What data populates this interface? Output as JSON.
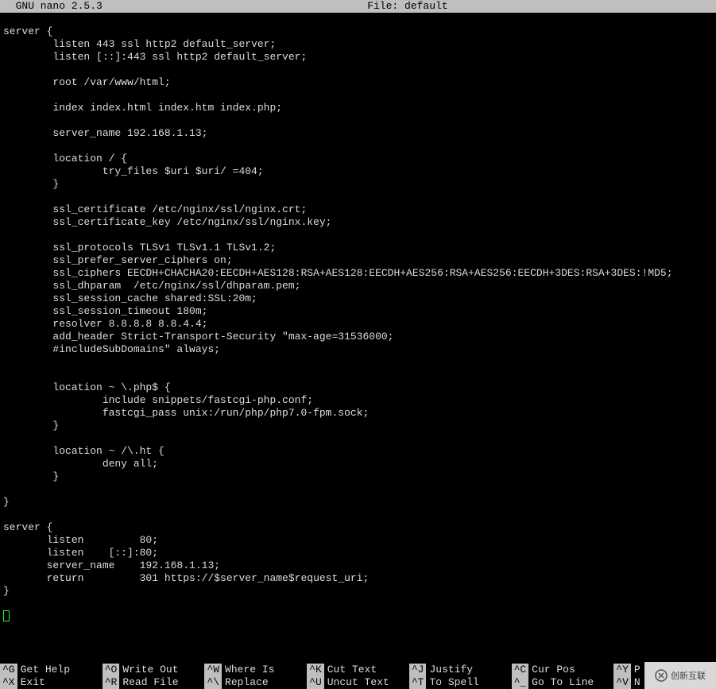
{
  "titlebar": {
    "app": "  GNU nano 2.5.3",
    "file": "File: default"
  },
  "content": "\nserver {\n        listen 443 ssl http2 default_server;\n        listen [::]:443 ssl http2 default_server;\n\n        root /var/www/html;\n\n        index index.html index.htm index.php;\n\n        server_name 192.168.1.13;\n\n        location / {\n                try_files $uri $uri/ =404;\n        }\n\n        ssl_certificate /etc/nginx/ssl/nginx.crt;\n        ssl_certificate_key /etc/nginx/ssl/nginx.key;\n\n        ssl_protocols TLSv1 TLSv1.1 TLSv1.2;\n        ssl_prefer_server_ciphers on;\n        ssl_ciphers EECDH+CHACHA20:EECDH+AES128:RSA+AES128:EECDH+AES256:RSA+AES256:EECDH+3DES:RSA+3DES:!MD5;\n        ssl_dhparam  /etc/nginx/ssl/dhparam.pem;\n        ssl_session_cache shared:SSL:20m;\n        ssl_session_timeout 180m;\n        resolver 8.8.8.8 8.8.4.4;\n        add_header Strict-Transport-Security \"max-age=31536000;\n        #includeSubDomains\" always;\n\n\n        location ~ \\.php$ {\n                include snippets/fastcgi-php.conf;\n                fastcgi_pass unix:/run/php/php7.0-fpm.sock;\n        }\n\n        location ~ /\\.ht {\n                deny all;\n        }\n\n}\n\nserver {\n       listen         80;\n       listen    [::]:80;\n       server_name    192.168.1.13;\n       return         301 https://$server_name$request_uri;\n}\n",
  "help": [
    {
      "key": "^G",
      "label": "Get Help"
    },
    {
      "key": "^O",
      "label": "Write Out"
    },
    {
      "key": "^W",
      "label": "Where Is"
    },
    {
      "key": "^K",
      "label": "Cut Text"
    },
    {
      "key": "^J",
      "label": "Justify"
    },
    {
      "key": "^C",
      "label": "Cur Pos"
    },
    {
      "key": "^Y",
      "label": "P"
    },
    {
      "key": "^X",
      "label": "Exit"
    },
    {
      "key": "^R",
      "label": "Read File"
    },
    {
      "key": "^\\",
      "label": "Replace"
    },
    {
      "key": "^U",
      "label": "Uncut Text"
    },
    {
      "key": "^T",
      "label": "To Spell"
    },
    {
      "key": "^_",
      "label": "Go To Line"
    },
    {
      "key": "^V",
      "label": "N"
    }
  ],
  "watermark": "创新互联"
}
